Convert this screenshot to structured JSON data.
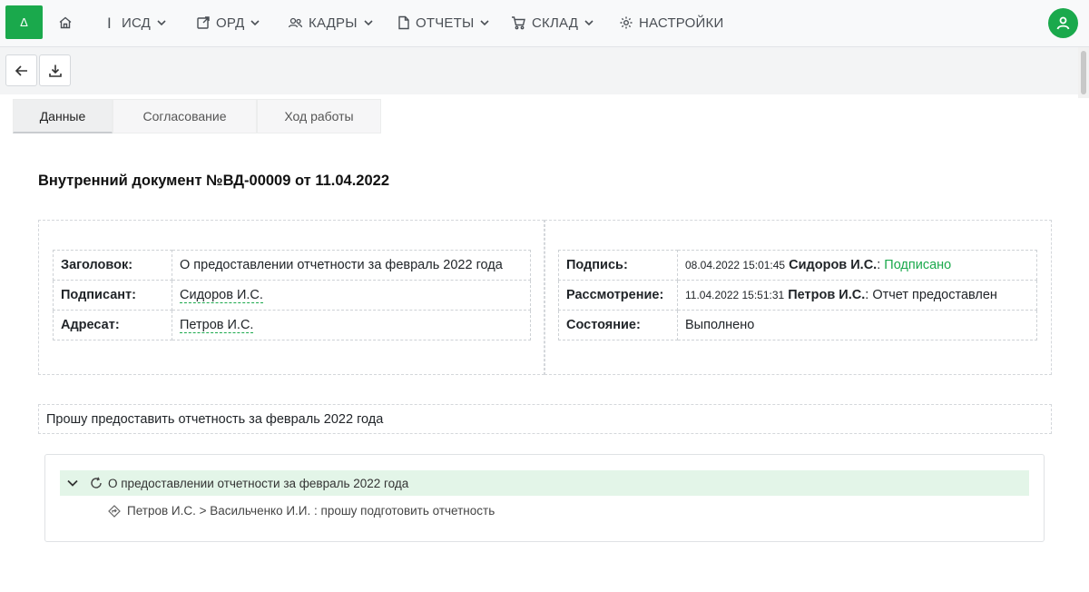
{
  "app": {
    "logo_text": "Δ",
    "accent_color": "#1aa94c"
  },
  "nav": {
    "items": [
      {
        "label": "ИСД",
        "icon": "info-icon",
        "has_dropdown": true
      },
      {
        "label": "ОРД",
        "icon": "external-link-icon",
        "has_dropdown": true
      },
      {
        "label": "КАДРЫ",
        "icon": "users-icon",
        "has_dropdown": true
      },
      {
        "label": "ОТЧЕТЫ",
        "icon": "file-icon",
        "has_dropdown": true
      },
      {
        "label": "СКЛАД",
        "icon": "cart-icon",
        "has_dropdown": true
      },
      {
        "label": "НАСТРОЙКИ",
        "icon": "gear-icon",
        "has_dropdown": false
      }
    ]
  },
  "tabs": [
    {
      "label": "Данные",
      "active": true
    },
    {
      "label": "Согласование",
      "active": false
    },
    {
      "label": "Ход работы",
      "active": false
    }
  ],
  "document": {
    "title": "Внутренний документ №ВД-00009 от 11.04.2022",
    "left_fields": [
      {
        "key": "Заголовок:",
        "value": "О предоставлении отчетности за февраль 2022 года"
      },
      {
        "key": "Подписант:",
        "value": "Сидоров И.С."
      },
      {
        "key": "Адресат:",
        "value": "Петров И.С."
      }
    ],
    "right_fields": {
      "signature": {
        "key": "Подпись:",
        "timestamp": "08.04.2022 15:01:45",
        "person": "Сидоров И.С.",
        "sep": ":",
        "status": "Подписано"
      },
      "review": {
        "key": "Рассмотрение:",
        "timestamp": "11.04.2022 15:51:31",
        "person": "Петров И.С.",
        "sep": ":",
        "status": "Отчет предоставлен"
      },
      "state": {
        "key": "Состояние:",
        "value": "Выполнено"
      }
    },
    "body_text": "Прошу предоставить отчетность за февраль 2022 года"
  },
  "workflow": {
    "root_label": "О предоставлении отчетности за февраль 2022 года",
    "child_label": "Петров И.С. > Васильченко И.И. : прошу подготовить отчетность"
  }
}
